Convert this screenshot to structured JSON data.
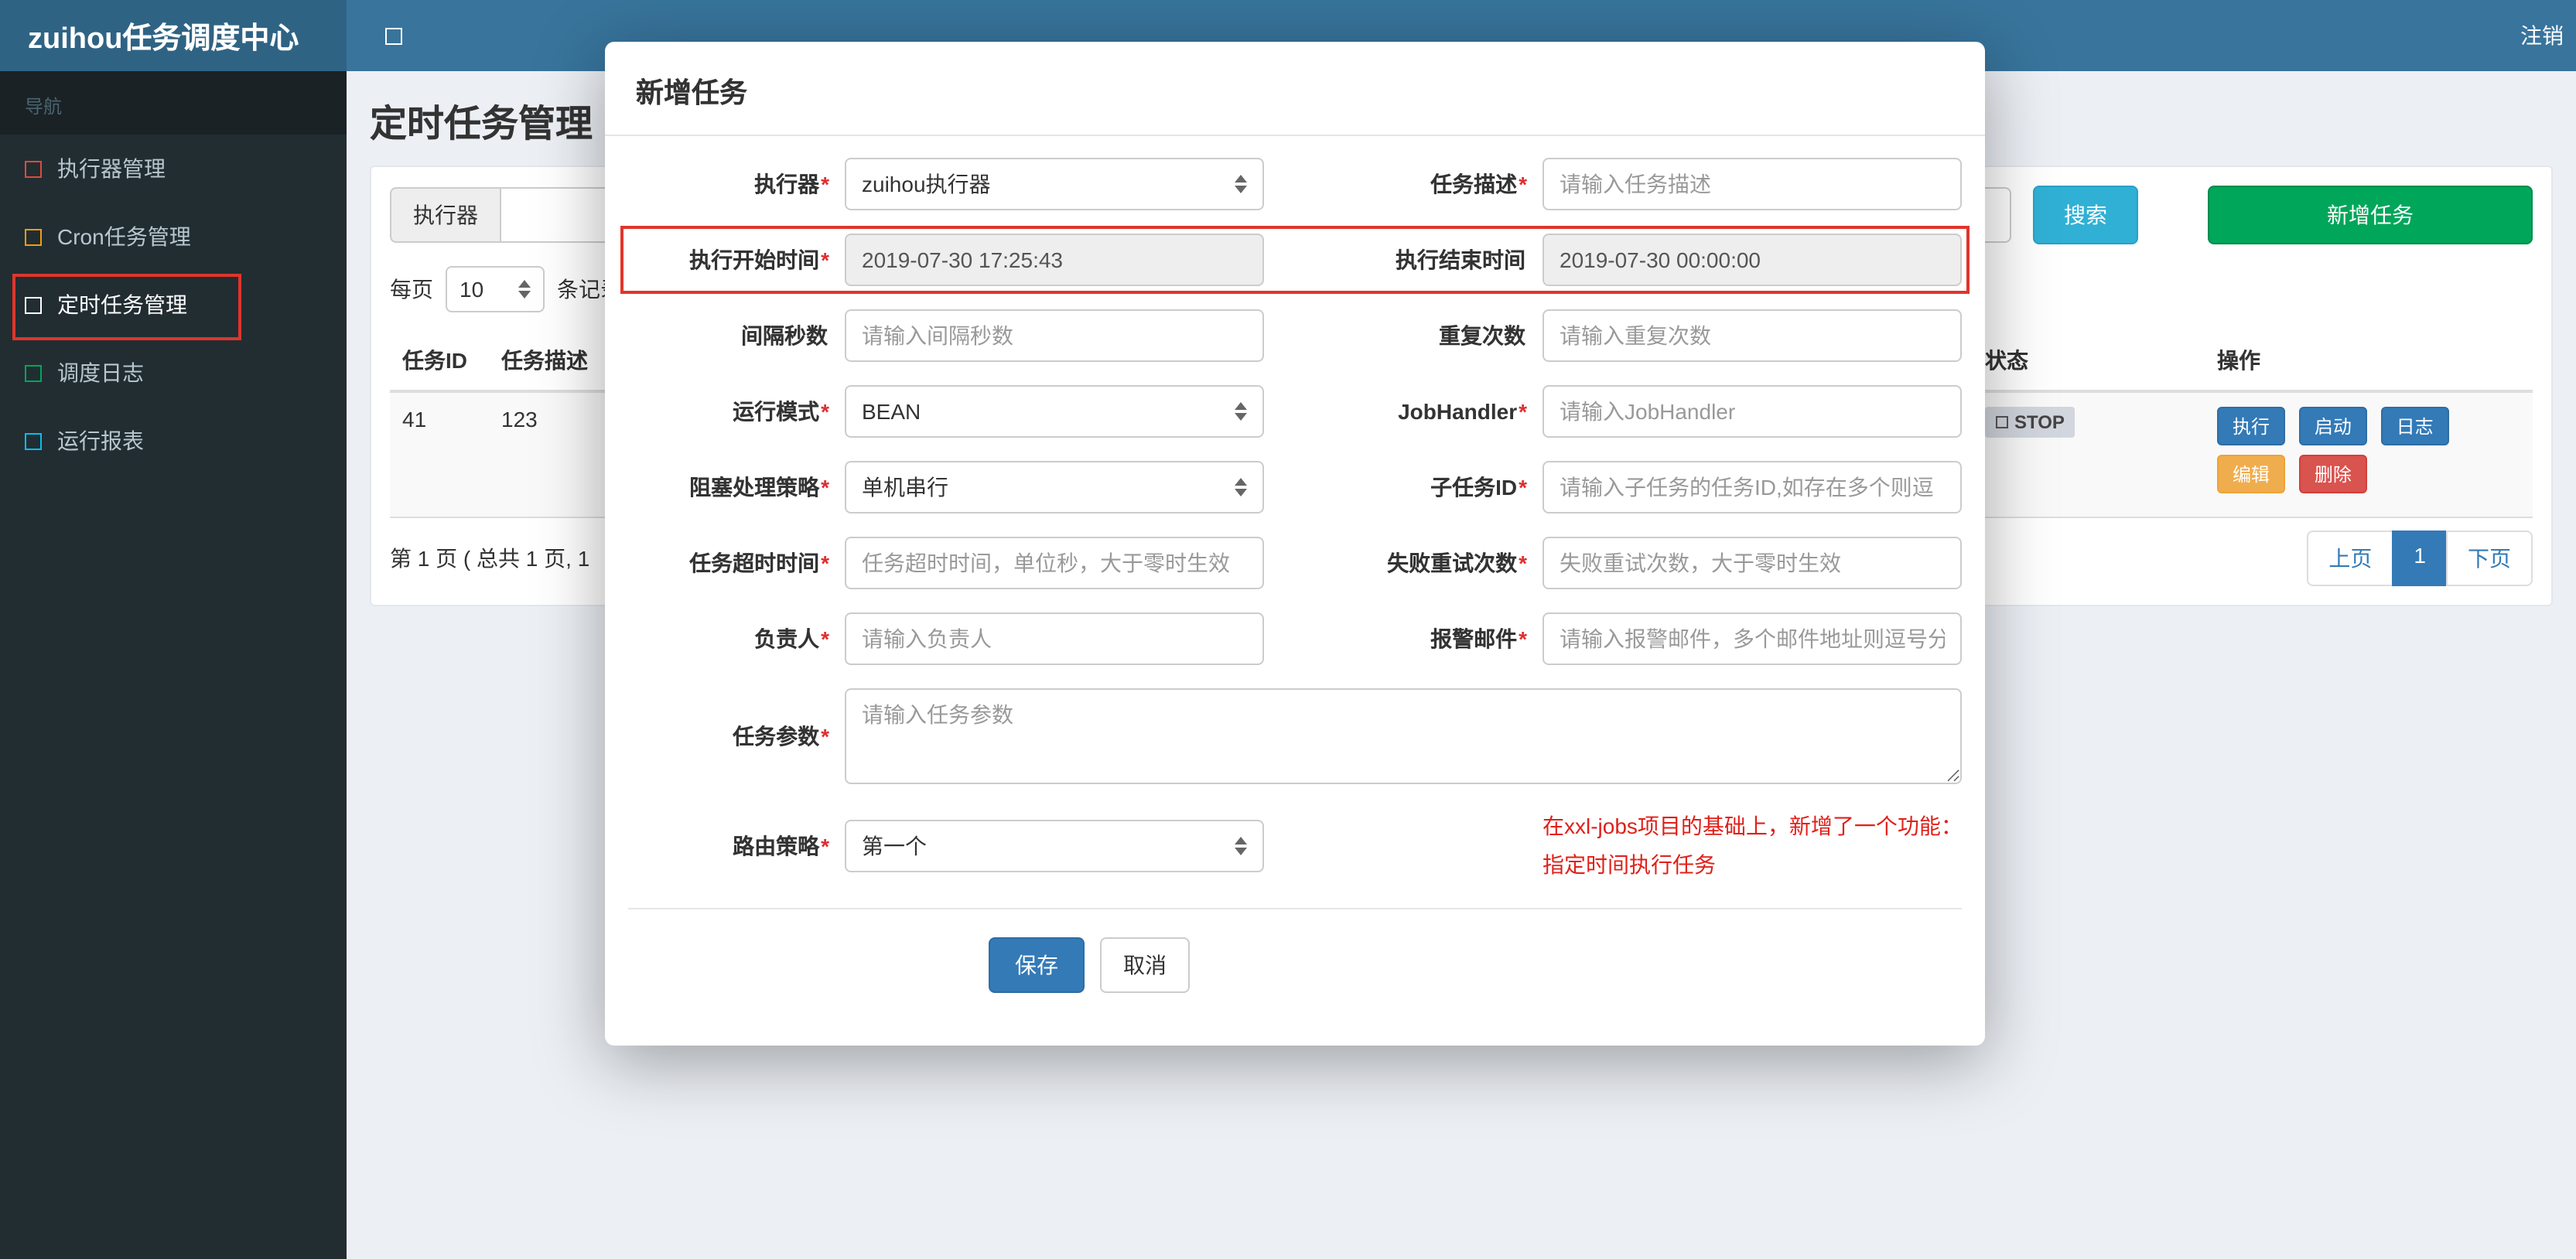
{
  "colors": {
    "navbar": "#38749c",
    "navbar_brand_bg": "#2f6384",
    "sidebar_bg": "#222d32",
    "primary": "#337ab7",
    "info": "#31b0d5",
    "success": "#00a65a",
    "warning": "#f0ad4e",
    "danger": "#d9534f",
    "annotation_red": "#e0352b"
  },
  "navbar": {
    "brand": "zuihou任务调度中心",
    "logout": "注销"
  },
  "sidebar": {
    "header": "导航",
    "items": [
      {
        "label": "执行器管理",
        "icon": "square-outline-icon",
        "icon_color": "#dd4b39"
      },
      {
        "label": "Cron任务管理",
        "icon": "square-outline-icon",
        "icon_color": "#f39c12"
      },
      {
        "label": "定时任务管理",
        "icon": "square-outline-icon",
        "icon_color": "#ffffff"
      },
      {
        "label": "调度日志",
        "icon": "square-outline-icon",
        "icon_color": "#00a65a"
      },
      {
        "label": "运行报表",
        "icon": "square-outline-icon",
        "icon_color": "#00c0ef"
      }
    ]
  },
  "page": {
    "title": "定时任务管理",
    "filter": {
      "executor_label": "执行器",
      "search_label": "搜索",
      "add_label": "新增任务"
    },
    "per_page": {
      "prefix": "每页",
      "value": "10",
      "suffix": "条记录"
    },
    "table": {
      "headers": {
        "id": "任务ID",
        "desc": "任务描述",
        "status": "状态",
        "actions": "操作"
      },
      "rows": [
        {
          "id": "41",
          "desc": "123",
          "status": "STOP",
          "actions": {
            "run": "执行",
            "start": "启动",
            "log": "日志",
            "edit": "编辑",
            "delete": "删除"
          }
        }
      ]
    },
    "pagination_info": "第 1 页 ( 总共 1 页, 1",
    "pager": {
      "prev": "上页",
      "current": "1",
      "next": "下页"
    }
  },
  "modal": {
    "title": "新增任务",
    "rows": [
      {
        "left": {
          "label": "执行器",
          "required": "*",
          "value": "zuihou执行器"
        },
        "right": {
          "label": "任务描述",
          "required": "*",
          "placeholder": "请输入任务描述"
        }
      },
      {
        "left": {
          "label": "执行开始时间",
          "required": "*",
          "value": "2019-07-30 17:25:43"
        },
        "right": {
          "label": "执行结束时间",
          "value": "2019-07-30 00:00:00"
        }
      },
      {
        "left": {
          "label": "间隔秒数",
          "placeholder": "请输入间隔秒数"
        },
        "right": {
          "label": "重复次数",
          "placeholder": "请输入重复次数"
        }
      },
      {
        "left": {
          "label": "运行模式",
          "required": "*",
          "value": "BEAN"
        },
        "right": {
          "label": "JobHandler",
          "required": "*",
          "placeholder": "请输入JobHandler"
        }
      },
      {
        "left": {
          "label": "阻塞处理策略",
          "required": "*",
          "value": "单机串行"
        },
        "right": {
          "label": "子任务ID",
          "required": "*",
          "placeholder": "请输入子任务的任务ID,如存在多个则逗"
        }
      },
      {
        "left": {
          "label": "任务超时时间",
          "required": "*",
          "placeholder": "任务超时时间，单位秒，大于零时生效"
        },
        "right": {
          "label": "失败重试次数",
          "required": "*",
          "placeholder": "失败重试次数，大于零时生效"
        }
      },
      {
        "left": {
          "label": "负责人",
          "required": "*",
          "placeholder": "请输入负责人"
        },
        "right": {
          "label": "报警邮件",
          "required": "*",
          "placeholder": "请输入报警邮件，多个邮件地址则逗号分"
        }
      }
    ],
    "params": {
      "label": "任务参数",
      "required": "*",
      "placeholder": "请输入任务参数"
    },
    "route": {
      "label": "路由策略",
      "required": "*",
      "value": "第一个"
    },
    "note_line1": "在xxl-jobs项目的基础上，新增了一个功能：",
    "note_line2": "指定时间执行任务",
    "save_label": "保存",
    "cancel_label": "取消"
  }
}
